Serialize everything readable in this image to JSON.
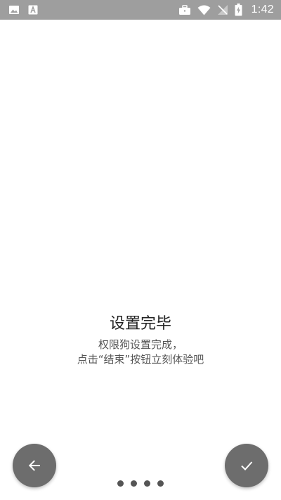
{
  "status_bar": {
    "time": "1:42",
    "left_icons": [
      "image-icon",
      "font-a-icon"
    ],
    "right_icons": [
      "briefcase-icon",
      "wifi-icon",
      "no-sim-icon",
      "battery-charging-icon"
    ],
    "background": "#9e9e9e"
  },
  "main": {
    "title": "设置完毕",
    "description_line1": "权限狗设置完成，",
    "description_line2": "点击“结束”按钮立刻体验吧"
  },
  "nav": {
    "back_icon": "arrow-left-icon",
    "done_icon": "checkmark-icon",
    "button_color": "#6d6d6d"
  },
  "pager": {
    "total_pages": 4
  }
}
